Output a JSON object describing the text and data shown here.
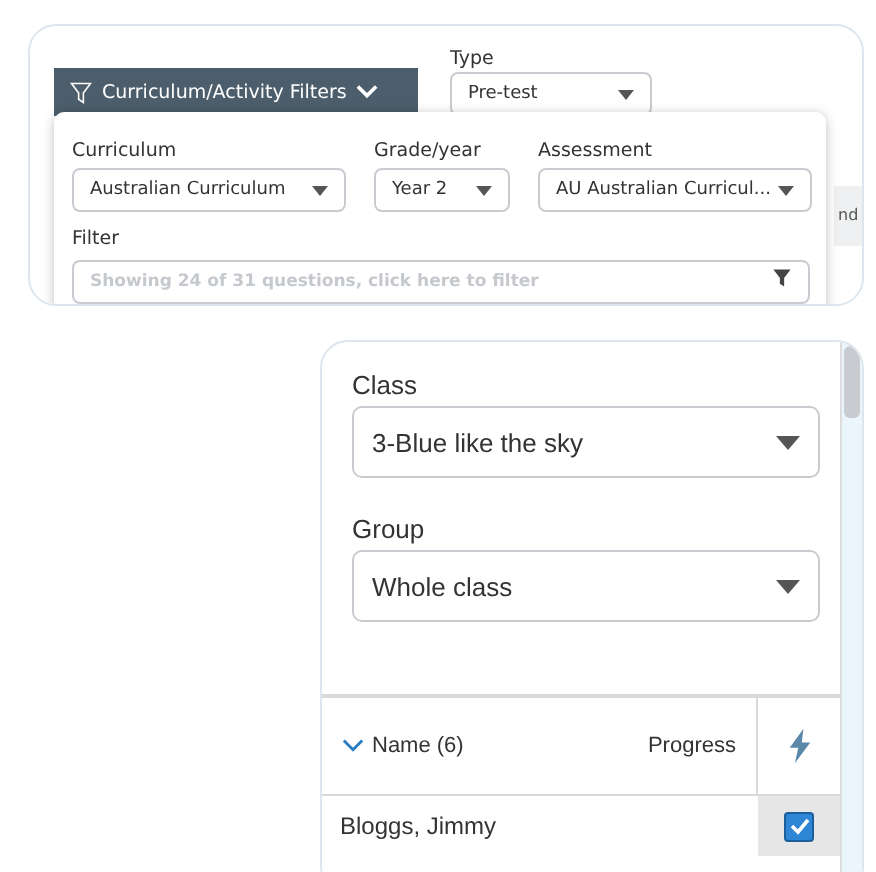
{
  "filters_panel": {
    "filter_button": {
      "label": "Curriculum/Activity Filters",
      "expanded": true
    },
    "type": {
      "label": "Type",
      "value": "Pre-test"
    },
    "background_header": "nd",
    "popover": {
      "selects": [
        {
          "label": "Curriculum",
          "value": "Australian Curriculum"
        },
        {
          "label": "Grade/year",
          "value": "Year 2"
        },
        {
          "label": "Assessment",
          "value": "AU Australian Curricul..."
        }
      ],
      "filter": {
        "label": "Filter",
        "placeholder": "Showing 24 of 31 questions, click here to filter"
      }
    }
  },
  "class_panel": {
    "selects": [
      {
        "label": "Class",
        "value": "3-Blue like the sky"
      },
      {
        "label": "Group",
        "value": "Whole class"
      }
    ],
    "table": {
      "name_column": "Name (6)",
      "progress_column": "Progress",
      "rows": [
        {
          "name": "Bloggs, Jimmy",
          "checked": true
        }
      ]
    }
  }
}
